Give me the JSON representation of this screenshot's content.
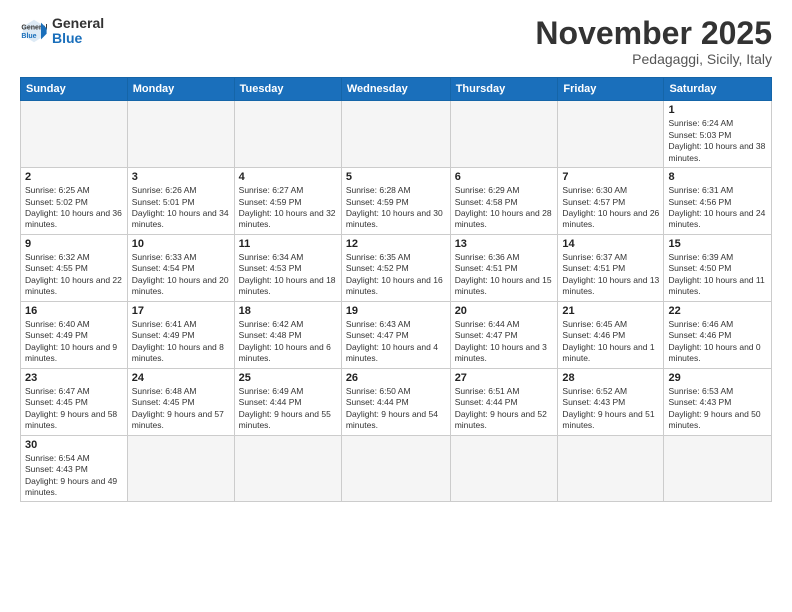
{
  "logo": {
    "general": "General",
    "blue": "Blue"
  },
  "header": {
    "month": "November 2025",
    "location": "Pedagaggi, Sicily, Italy"
  },
  "days_of_week": [
    "Sunday",
    "Monday",
    "Tuesday",
    "Wednesday",
    "Thursday",
    "Friday",
    "Saturday"
  ],
  "weeks": [
    [
      {
        "day": "",
        "info": ""
      },
      {
        "day": "",
        "info": ""
      },
      {
        "day": "",
        "info": ""
      },
      {
        "day": "",
        "info": ""
      },
      {
        "day": "",
        "info": ""
      },
      {
        "day": "",
        "info": ""
      },
      {
        "day": "1",
        "info": "Sunrise: 6:24 AM\nSunset: 5:03 PM\nDaylight: 10 hours and 38 minutes."
      }
    ],
    [
      {
        "day": "2",
        "info": "Sunrise: 6:25 AM\nSunset: 5:02 PM\nDaylight: 10 hours and 36 minutes."
      },
      {
        "day": "3",
        "info": "Sunrise: 6:26 AM\nSunset: 5:01 PM\nDaylight: 10 hours and 34 minutes."
      },
      {
        "day": "4",
        "info": "Sunrise: 6:27 AM\nSunset: 4:59 PM\nDaylight: 10 hours and 32 minutes."
      },
      {
        "day": "5",
        "info": "Sunrise: 6:28 AM\nSunset: 4:59 PM\nDaylight: 10 hours and 30 minutes."
      },
      {
        "day": "6",
        "info": "Sunrise: 6:29 AM\nSunset: 4:58 PM\nDaylight: 10 hours and 28 minutes."
      },
      {
        "day": "7",
        "info": "Sunrise: 6:30 AM\nSunset: 4:57 PM\nDaylight: 10 hours and 26 minutes."
      },
      {
        "day": "8",
        "info": "Sunrise: 6:31 AM\nSunset: 4:56 PM\nDaylight: 10 hours and 24 minutes."
      }
    ],
    [
      {
        "day": "9",
        "info": "Sunrise: 6:32 AM\nSunset: 4:55 PM\nDaylight: 10 hours and 22 minutes."
      },
      {
        "day": "10",
        "info": "Sunrise: 6:33 AM\nSunset: 4:54 PM\nDaylight: 10 hours and 20 minutes."
      },
      {
        "day": "11",
        "info": "Sunrise: 6:34 AM\nSunset: 4:53 PM\nDaylight: 10 hours and 18 minutes."
      },
      {
        "day": "12",
        "info": "Sunrise: 6:35 AM\nSunset: 4:52 PM\nDaylight: 10 hours and 16 minutes."
      },
      {
        "day": "13",
        "info": "Sunrise: 6:36 AM\nSunset: 4:51 PM\nDaylight: 10 hours and 15 minutes."
      },
      {
        "day": "14",
        "info": "Sunrise: 6:37 AM\nSunset: 4:51 PM\nDaylight: 10 hours and 13 minutes."
      },
      {
        "day": "15",
        "info": "Sunrise: 6:39 AM\nSunset: 4:50 PM\nDaylight: 10 hours and 11 minutes."
      }
    ],
    [
      {
        "day": "16",
        "info": "Sunrise: 6:40 AM\nSunset: 4:49 PM\nDaylight: 10 hours and 9 minutes."
      },
      {
        "day": "17",
        "info": "Sunrise: 6:41 AM\nSunset: 4:49 PM\nDaylight: 10 hours and 8 minutes."
      },
      {
        "day": "18",
        "info": "Sunrise: 6:42 AM\nSunset: 4:48 PM\nDaylight: 10 hours and 6 minutes."
      },
      {
        "day": "19",
        "info": "Sunrise: 6:43 AM\nSunset: 4:47 PM\nDaylight: 10 hours and 4 minutes."
      },
      {
        "day": "20",
        "info": "Sunrise: 6:44 AM\nSunset: 4:47 PM\nDaylight: 10 hours and 3 minutes."
      },
      {
        "day": "21",
        "info": "Sunrise: 6:45 AM\nSunset: 4:46 PM\nDaylight: 10 hours and 1 minute."
      },
      {
        "day": "22",
        "info": "Sunrise: 6:46 AM\nSunset: 4:46 PM\nDaylight: 10 hours and 0 minutes."
      }
    ],
    [
      {
        "day": "23",
        "info": "Sunrise: 6:47 AM\nSunset: 4:45 PM\nDaylight: 9 hours and 58 minutes."
      },
      {
        "day": "24",
        "info": "Sunrise: 6:48 AM\nSunset: 4:45 PM\nDaylight: 9 hours and 57 minutes."
      },
      {
        "day": "25",
        "info": "Sunrise: 6:49 AM\nSunset: 4:44 PM\nDaylight: 9 hours and 55 minutes."
      },
      {
        "day": "26",
        "info": "Sunrise: 6:50 AM\nSunset: 4:44 PM\nDaylight: 9 hours and 54 minutes."
      },
      {
        "day": "27",
        "info": "Sunrise: 6:51 AM\nSunset: 4:44 PM\nDaylight: 9 hours and 52 minutes."
      },
      {
        "day": "28",
        "info": "Sunrise: 6:52 AM\nSunset: 4:43 PM\nDaylight: 9 hours and 51 minutes."
      },
      {
        "day": "29",
        "info": "Sunrise: 6:53 AM\nSunset: 4:43 PM\nDaylight: 9 hours and 50 minutes."
      }
    ],
    [
      {
        "day": "30",
        "info": "Sunrise: 6:54 AM\nSunset: 4:43 PM\nDaylight: 9 hours and 49 minutes."
      },
      {
        "day": "",
        "info": ""
      },
      {
        "day": "",
        "info": ""
      },
      {
        "day": "",
        "info": ""
      },
      {
        "day": "",
        "info": ""
      },
      {
        "day": "",
        "info": ""
      },
      {
        "day": "",
        "info": ""
      }
    ]
  ]
}
